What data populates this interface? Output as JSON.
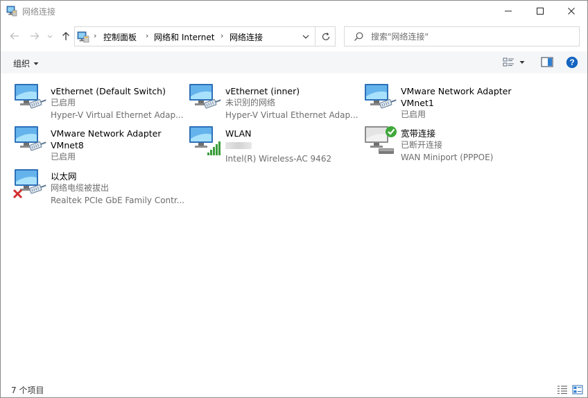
{
  "window": {
    "title": "网络连接",
    "icon": "network-connections-icon"
  },
  "address": {
    "crumbs": [
      "控制面板",
      "网络和 Internet",
      "网络连接"
    ]
  },
  "search": {
    "placeholder": "搜索\"网络连接\""
  },
  "commandbar": {
    "organize_label": "组织"
  },
  "items": [
    {
      "name": "vEthernet (Default Switch)",
      "name2": "",
      "status": "已启用",
      "device": "Hyper-V Virtual Ethernet Adap...",
      "icon": "ethernet-adapter-icon",
      "overlay": ""
    },
    {
      "name": "vEthernet (inner)",
      "name2": "",
      "status": "未识别的网络",
      "device": "Hyper-V Virtual Ethernet Adap...",
      "icon": "ethernet-adapter-icon",
      "overlay": ""
    },
    {
      "name": "VMware Network Adapter",
      "name2": "VMnet1",
      "status": "已启用",
      "device": "",
      "icon": "ethernet-adapter-icon",
      "overlay": ""
    },
    {
      "name": "VMware Network Adapter",
      "name2": "VMnet8",
      "status": "已启用",
      "device": "",
      "icon": "ethernet-adapter-icon",
      "overlay": ""
    },
    {
      "name": "WLAN",
      "name2": "",
      "status": "",
      "device": "Intel(R) Wireless-AC 9462",
      "icon": "wifi-adapter-icon",
      "overlay": "signal-bars"
    },
    {
      "name": "宽带连接",
      "name2": "",
      "status": "已断开连接",
      "device": "WAN Miniport (PPPOE)",
      "icon": "broadband-adapter-icon",
      "overlay": "check"
    },
    {
      "name": "以太网",
      "name2": "",
      "status": "网络电缆被拔出",
      "device": "Realtek PCIe GbE Family Contr...",
      "icon": "ethernet-adapter-icon",
      "overlay": "error-x"
    }
  ],
  "statusbar": {
    "count": "7 个项目"
  },
  "colors": {
    "accent_blue": "#1f78d1",
    "secondary_text": "#6d6d6d",
    "commandbar_bg": "#f5f6f7",
    "help_blue": "#1565c0",
    "error_red": "#d32f2f",
    "check_green": "#3fa83a",
    "signal_green": "#3a9c3a"
  }
}
